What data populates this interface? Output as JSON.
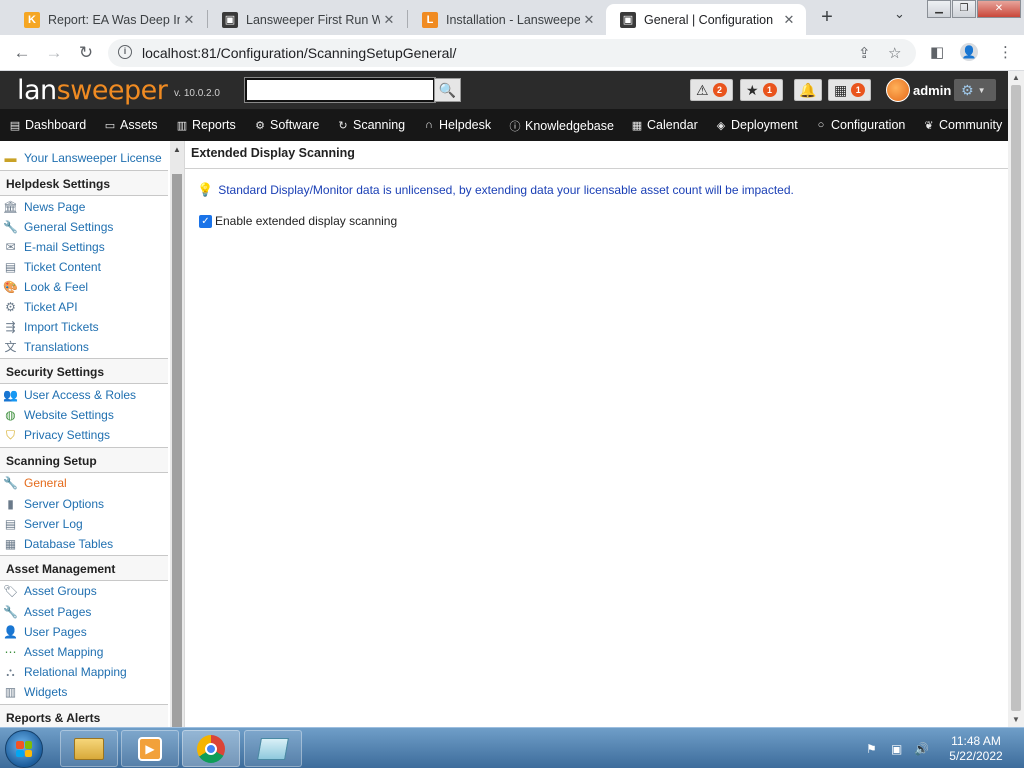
{
  "browser": {
    "tabs": [
      {
        "title": "Report: EA Was Deep In F",
        "favicon": "kaleyra-k-icon",
        "fav_color": "#f5a623",
        "fav_glyph": "K"
      },
      {
        "title": "Lansweeper First Run Wiz",
        "favicon": "lansweeper-icon",
        "fav_color": "#3a3a3a",
        "fav_glyph": "▣"
      },
      {
        "title": "Installation - Lansweeper",
        "favicon": "lansweeper-l-icon",
        "fav_color": "#f08b22",
        "fav_glyph": "L"
      },
      {
        "title": "General | Configuration",
        "favicon": "lansweeper-icon",
        "fav_color": "#3a3a3a",
        "fav_glyph": "▣"
      }
    ],
    "url": "localhost:81/Configuration/ScanningSetupGeneral/"
  },
  "header": {
    "logo_part1": "lan",
    "logo_part2": "sweeper",
    "version": "v. 10.0.2.0",
    "search_value": "",
    "alerts_count": "2",
    "favorites_count": "1",
    "calendar_count": "1",
    "username": "admin"
  },
  "menu": [
    {
      "label": "Dashboard",
      "icon": "dashboard-icon",
      "glyph": "▤"
    },
    {
      "label": "Assets",
      "icon": "monitor-icon",
      "glyph": "▭"
    },
    {
      "label": "Reports",
      "icon": "report-icon",
      "glyph": "▥"
    },
    {
      "label": "Software",
      "icon": "software-icon",
      "glyph": "⚙"
    },
    {
      "label": "Scanning",
      "icon": "scanning-icon",
      "glyph": "↻"
    },
    {
      "label": "Helpdesk",
      "icon": "headset-icon",
      "glyph": "∩"
    },
    {
      "label": "Knowledgebase",
      "icon": "info-icon",
      "glyph": "ⓘ"
    },
    {
      "label": "Calendar",
      "icon": "calendar-icon",
      "glyph": "▦"
    },
    {
      "label": "Deployment",
      "icon": "package-icon",
      "glyph": "◈"
    },
    {
      "label": "Configuration",
      "icon": "config-icon",
      "glyph": "○"
    },
    {
      "label": "Community",
      "icon": "community-icon",
      "glyph": "❦"
    }
  ],
  "sidebar": {
    "license": "Your Lansweeper License",
    "sections": [
      {
        "title": "Helpdesk Settings",
        "items": [
          "News Page",
          "General Settings",
          "E-mail Settings",
          "Ticket Content",
          "Look & Feel",
          "Ticket API",
          "Import Tickets",
          "Translations"
        ]
      },
      {
        "title": "Security Settings",
        "items": [
          "User Access & Roles",
          "Website Settings",
          "Privacy Settings"
        ]
      },
      {
        "title": "Scanning Setup",
        "items": [
          "General",
          "Server Options",
          "Server Log",
          "Database Tables"
        ]
      },
      {
        "title": "Asset Management",
        "items": [
          "Asset Groups",
          "Asset Pages",
          "User Pages",
          "Asset Mapping",
          "Relational Mapping",
          "Widgets"
        ]
      },
      {
        "title": "Reports & Alerts",
        "items": []
      }
    ],
    "active_item": "General"
  },
  "content": {
    "title": "Extended Display Scanning",
    "notice": "Standard Display/Monitor data is unlicensed, by extending data your licensable asset count will be impacted.",
    "checkbox_label": "Enable extended display scanning",
    "checkbox_checked": true
  },
  "taskbar": {
    "time": "11:48 AM",
    "date": "5/22/2022"
  }
}
